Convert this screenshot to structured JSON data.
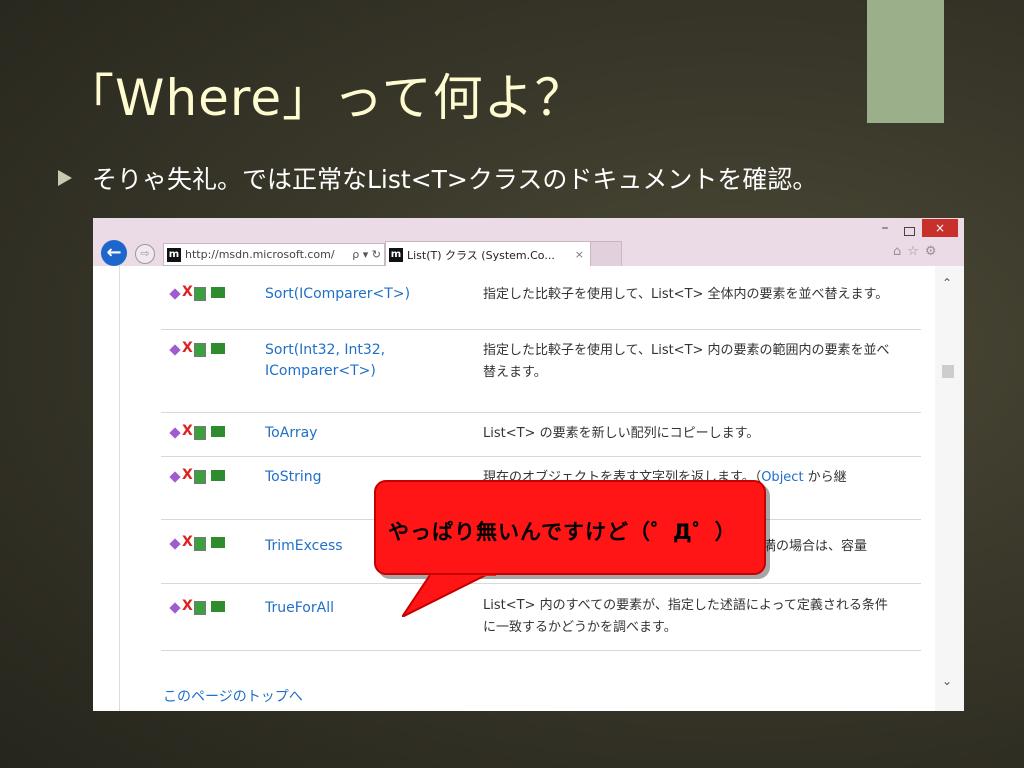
{
  "slide": {
    "title": "「Where」って何よ？",
    "bullet": "そりゃ失礼。では正常なList<T>クラスのドキュメントを確認。"
  },
  "browser": {
    "back_icon": "←",
    "forward_icon": "⇨",
    "site_icon_letter": "m",
    "address": "http://msdn.microsoft.com/",
    "address_icons": "ρ ▾ ↻",
    "tab_title": "List(T) クラス (System.Co...",
    "tab_close": "×",
    "window_minimize": "–",
    "window_close": "×",
    "toolbar_icons": {
      "home": "⌂",
      "favorites": "☆",
      "settings": "⚙"
    }
  },
  "members": [
    {
      "name": "Sort(IComparer<T>)",
      "description": "指定した比較子を使用して、List<T> 全体内の要素を並べ替えます。"
    },
    {
      "name": "Sort(Int32, Int32, IComparer<T>)",
      "description": "指定した比較子を使用して、List<T> 内の要素の範囲内の要素を並べ替えます。"
    },
    {
      "name": "ToArray",
      "description": "List<T> の要素を新しい配列にコピーします。"
    },
    {
      "name": "ToString",
      "description": "現在のオブジェクトを表す文字列を返します。（",
      "link": "Object",
      "description_tail": " から継"
    },
    {
      "name": "TrimExcess",
      "description": "満の場合は、容量"
    },
    {
      "name": "TrueForAll",
      "description": "List<T> 内のすべての要素が、指定した述語によって定義される条件に一致するかどうかを調べます。"
    }
  ],
  "page_top_link": "このページのトップへ",
  "callout": {
    "text": "やっぱり無いんですけど（゜Д゜）",
    "color": "#ff1515"
  },
  "scroll": {
    "up": "⌃",
    "down": "⌄"
  }
}
